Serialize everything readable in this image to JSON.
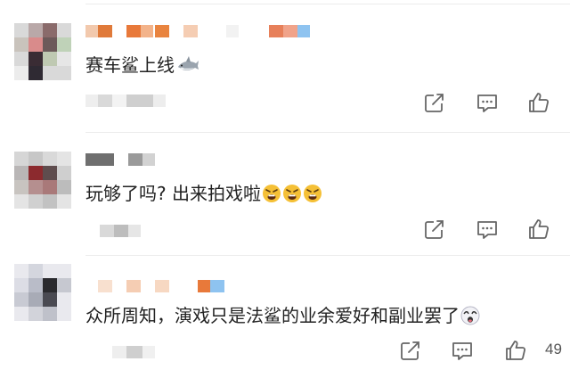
{
  "comments": [
    {
      "text": "赛车鲨上线",
      "emoji": "shark-emoji",
      "like_count": ""
    },
    {
      "text": "玩够了吗? 出来拍戏啦",
      "emoji": "angry-face-emoji",
      "like_count": ""
    },
    {
      "text": "众所周知，演戏只是法鲨的业余爱好和副业罢了",
      "emoji": "dizzy-face-emoji",
      "like_count": "49"
    }
  ],
  "icons": {
    "share": "share-icon",
    "reply": "comment-icon",
    "like": "thumbs-up-icon"
  },
  "colors": {
    "text": "#222222",
    "icon": "#666666",
    "emoji_yellow": "#f5c036",
    "mosaic_orange": "#e8793a",
    "mosaic_blue": "#8ec3f0"
  }
}
